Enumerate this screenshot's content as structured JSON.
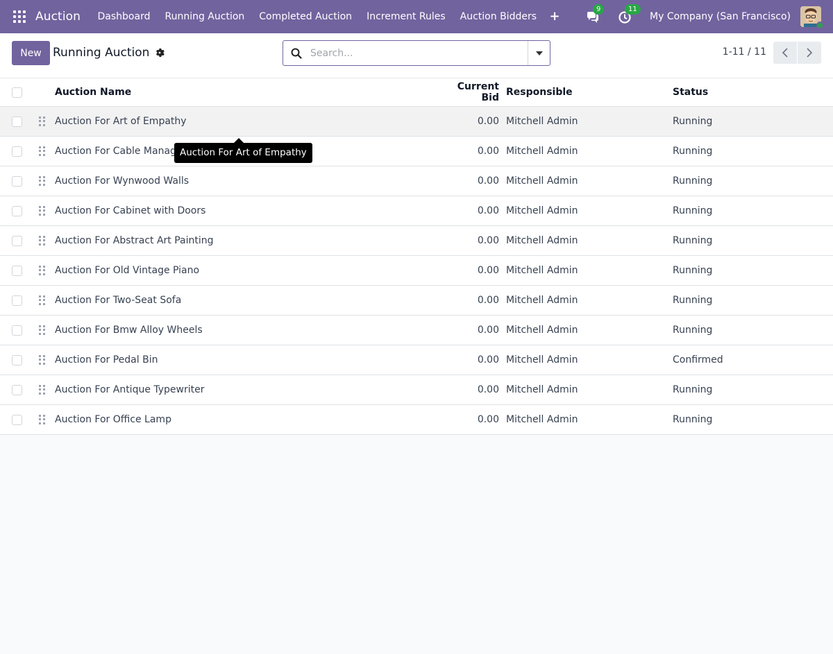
{
  "navbar": {
    "app_name": "Auction",
    "menu": [
      {
        "label": "Dashboard"
      },
      {
        "label": "Running Auction"
      },
      {
        "label": "Completed Auction"
      },
      {
        "label": "Increment Rules"
      },
      {
        "label": "Auction Bidders"
      }
    ],
    "plus_label": "+",
    "messages_count": "9",
    "activities_count": "11",
    "company": "My Company (San Francisco)",
    "icons": {
      "apps": "apps-grid-icon",
      "messages": "chat-icon",
      "activities": "clock-icon",
      "avatar": "user-avatar"
    },
    "colors": {
      "brand": "#71639e",
      "badge": "#28a745"
    }
  },
  "control_panel": {
    "new_label": "New",
    "title": "Running Auction",
    "search_placeholder": "Search...",
    "pager": "1-11 / 11"
  },
  "list": {
    "columns": {
      "name": "Auction Name",
      "bid": "Current Bid",
      "responsible": "Responsible",
      "status": "Status"
    },
    "rows": [
      {
        "name": "Auction For Art of Empathy",
        "bid": "0.00",
        "responsible": "Mitchell Admin",
        "status": "Running"
      },
      {
        "name": "Auction For Cable Manage",
        "bid": "0.00",
        "responsible": "Mitchell Admin",
        "status": "Running"
      },
      {
        "name": "Auction For Wynwood Walls",
        "bid": "0.00",
        "responsible": "Mitchell Admin",
        "status": "Running"
      },
      {
        "name": "Auction For Cabinet with Doors",
        "bid": "0.00",
        "responsible": "Mitchell Admin",
        "status": "Running"
      },
      {
        "name": "Auction For Abstract Art Painting",
        "bid": "0.00",
        "responsible": "Mitchell Admin",
        "status": "Running"
      },
      {
        "name": "Auction For Old Vintage Piano",
        "bid": "0.00",
        "responsible": "Mitchell Admin",
        "status": "Running"
      },
      {
        "name": "Auction For Two-Seat Sofa",
        "bid": "0.00",
        "responsible": "Mitchell Admin",
        "status": "Running"
      },
      {
        "name": "Auction For Bmw Alloy Wheels",
        "bid": "0.00",
        "responsible": "Mitchell Admin",
        "status": "Running"
      },
      {
        "name": "Auction For Pedal Bin",
        "bid": "0.00",
        "responsible": "Mitchell Admin",
        "status": "Confirmed"
      },
      {
        "name": "Auction For Antique Typewriter",
        "bid": "0.00",
        "responsible": "Mitchell Admin",
        "status": "Running"
      },
      {
        "name": "Auction For Office Lamp",
        "bid": "0.00",
        "responsible": "Mitchell Admin",
        "status": "Running"
      }
    ]
  },
  "tooltip": {
    "text": "Auction For Art of Empathy"
  }
}
